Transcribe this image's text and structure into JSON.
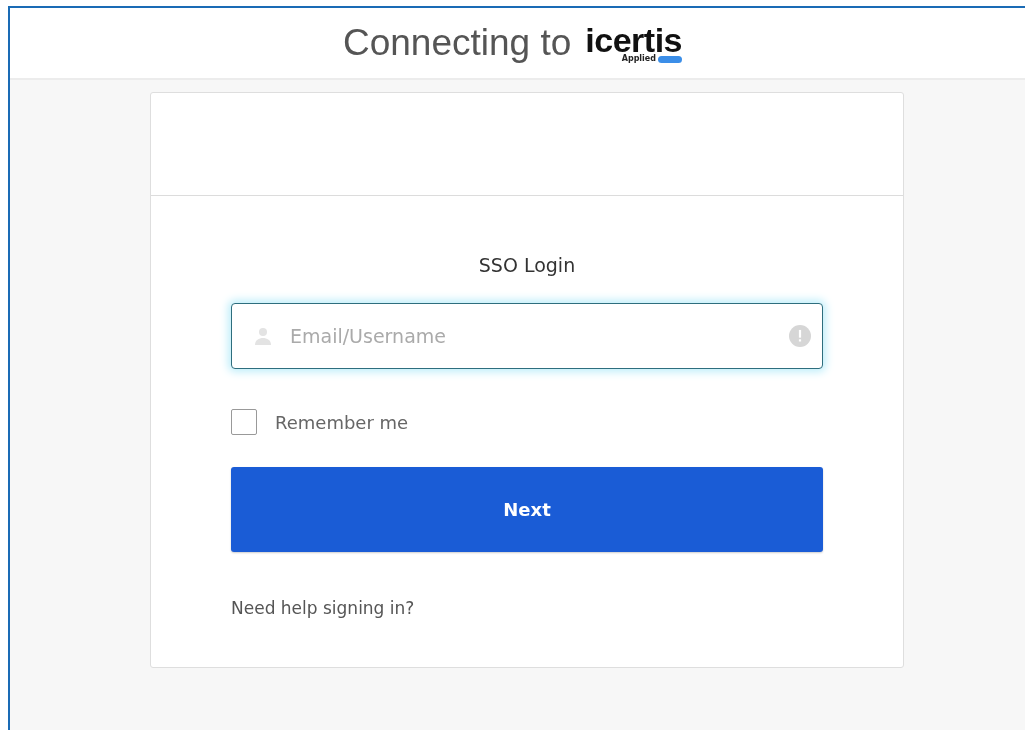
{
  "header": {
    "title": "Connecting to",
    "logo": {
      "name": "icertis",
      "tagline": "Applied"
    }
  },
  "login": {
    "title": "SSO Login",
    "username": {
      "placeholder": "Email/Username",
      "focused": true
    },
    "remember": {
      "label": "Remember me",
      "checked": false
    },
    "submit": "Next",
    "help_link": "Need help signing in?"
  }
}
